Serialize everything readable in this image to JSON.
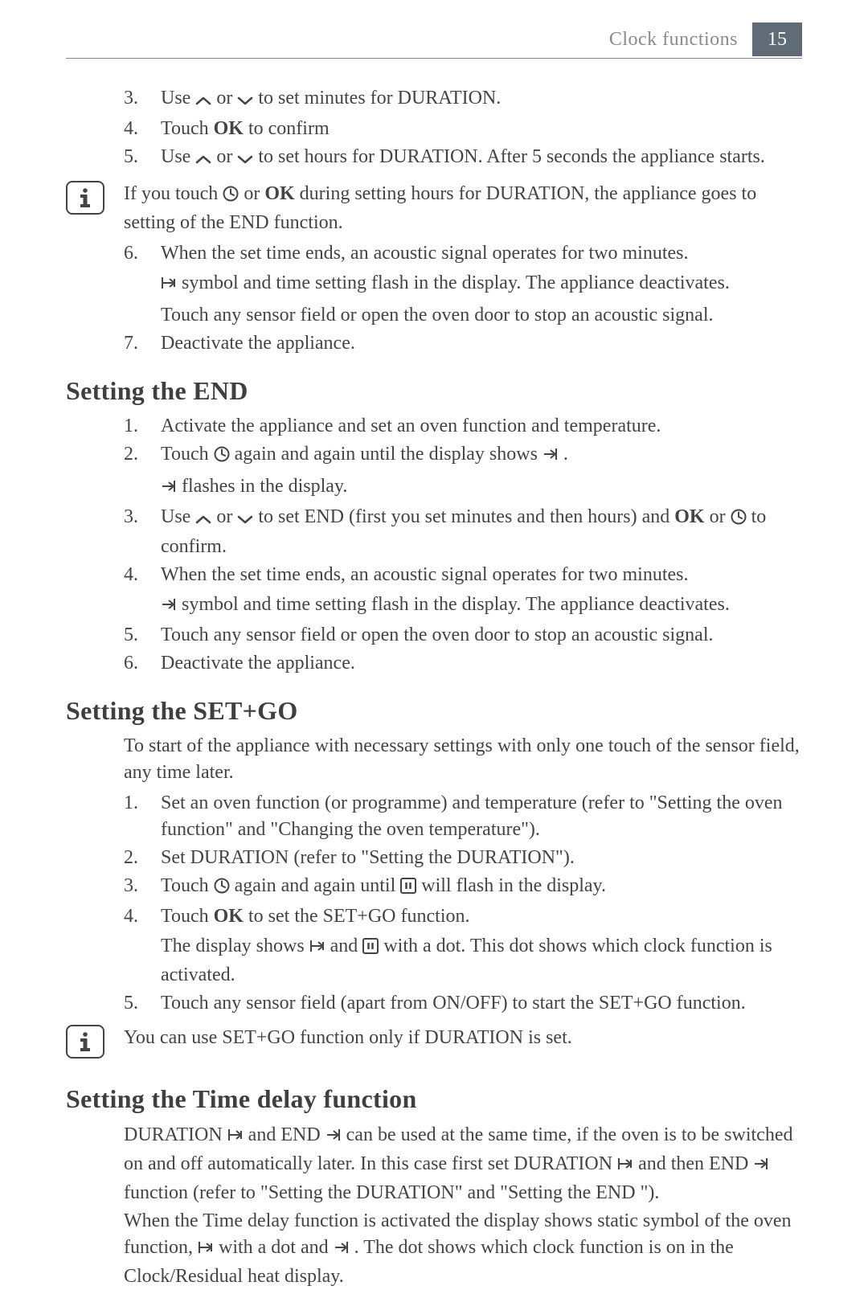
{
  "header": {
    "section": "Clock functions",
    "page": "15"
  },
  "top_steps": {
    "s3_pre": "Use ",
    "s3_post": " to set minutes for DURATION.",
    "s4_pre": "Touch ",
    "s4_post": " to confirm",
    "s5_pre": "Use ",
    "s5_post": " to set hours for DURATION. After 5 seconds the appliance starts."
  },
  "or": " or ",
  "info1_pre": "If you touch ",
  "info1_mid1": " or ",
  "info1_post": " during setting hours for DURATION, the appliance goes to setting of the END function.",
  "step6": {
    "line1": "When the set time ends, an acoustic signal operates for two minutes.",
    "line2_post": " symbol and time setting flash in the display. The appliance deactivates.",
    "line3": "Touch any sensor field or open the oven door to stop an acoustic signal."
  },
  "step7": "Deactivate the appliance.",
  "ok_label": "OK",
  "end": {
    "title": "Setting the END",
    "s1": "Activate the appliance and set an oven function and temperature.",
    "s2_pre": "Touch ",
    "s2_mid": " again and again until the display shows ",
    "s2_post": " .",
    "s2_sub_post": " flashes in the display.",
    "s3_pre": "Use ",
    "s3_mid": " to set END (first you set minutes and then hours) and ",
    "s3_or": " or ",
    "s3_post": " to confirm.",
    "s4_line1": "When the set time ends, an acoustic signal operates for two minutes.",
    "s4_line2_post": " symbol and time setting flash in the display. The appliance deactivates.",
    "s5": "Touch any sensor field or open the oven door to stop an acoustic signal.",
    "s6": "Deactivate the appliance."
  },
  "setgo": {
    "title": "Setting the SET+GO",
    "intro": "To start of the appliance with necessary settings with only one touch of the sensor field, any time later.",
    "s1": "Set an oven function (or programme) and temperature (refer to \"Setting the oven function\" and \"Changing the oven temperature\").",
    "s2": "Set DURATION (refer to \"Setting the DURATION\").",
    "s3_pre": "Touch ",
    "s3_mid": " again and again until ",
    "s3_post": " will flash in the display.",
    "s4_pre": "Touch ",
    "s4_post": " to set the SET+GO function.",
    "s4_sub_pre": "The display shows ",
    "s4_sub_mid": " and ",
    "s4_sub_post": " with a dot. This dot shows which clock function is activated.",
    "s5": "Touch any sensor field (apart from ON/OFF) to start the SET+GO function."
  },
  "info2": "You can use SET+GO function only if DURATION is set.",
  "delay": {
    "title": "Setting the Time delay function",
    "p1_pre": "DURATION ",
    "p1_mid1": " and END ",
    "p1_mid2": " can be used at the same time, if the oven is to be switched on and off automatically later. In this case first set DURATION ",
    "p1_mid3": " and then END ",
    "p1_post": " function (refer to \"Setting the DURATION\" and \"Setting the END \").",
    "p2_pre": "When the Time delay function is activated the display shows static symbol of the oven function, ",
    "p2_mid": " with a dot and ",
    "p2_post": " . The dot shows which clock function is on in the Clock/Residual heat display."
  },
  "nums": {
    "n1": "1.",
    "n2": "2.",
    "n3": "3.",
    "n4": "4.",
    "n5": "5.",
    "n6": "6.",
    "n7": "7."
  }
}
